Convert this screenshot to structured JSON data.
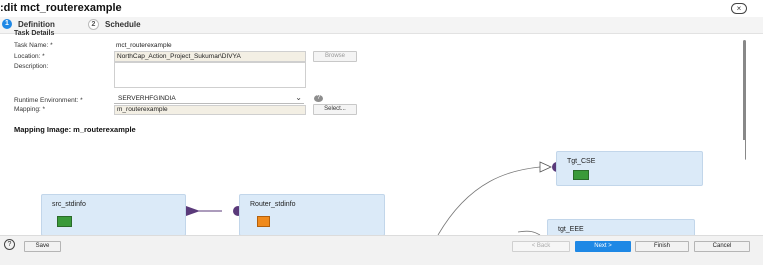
{
  "window": {
    "title": ":dit mct_routerexample",
    "close_label": "×"
  },
  "steps": [
    {
      "number": "1",
      "label": "Definition"
    },
    {
      "number": "2",
      "label": "Schedule"
    }
  ],
  "form": {
    "section_title": "Task Details",
    "task_name_label": "Task Name: *",
    "task_name_value": "mct_routerexample",
    "location_label": "Location: *",
    "location_value": "NorthCap_Action_Project_Sukumar\\DIVYA",
    "browse_label": "Browse",
    "description_label": "Description:",
    "description_value": "",
    "runtime_label": "Runtime Environment: *",
    "runtime_value": "SERVERHFGINDIA",
    "help_glyph": "?",
    "mapping_label": "Mapping: *",
    "mapping_value": "m_routerexample",
    "select_label": "Select..."
  },
  "mapping_image": {
    "title": "Mapping Image:  m_routerexample",
    "nodes": [
      {
        "name": "src_stdinfo"
      },
      {
        "name": "Router_stdinfo"
      },
      {
        "name": "Tgt_CSE"
      },
      {
        "name": "tgt_EEE"
      }
    ]
  },
  "footer": {
    "help_glyph": "?",
    "save_label": "Save",
    "back_label": "< Back",
    "next_label": "Next >",
    "finish_label": "Finish",
    "cancel_label": "Cancel"
  },
  "colors": {
    "accent": "#1e88e5",
    "node_fill": "#dbeaf8",
    "connector": "#5a3a7a",
    "readonly_field": "#f3efe4"
  }
}
